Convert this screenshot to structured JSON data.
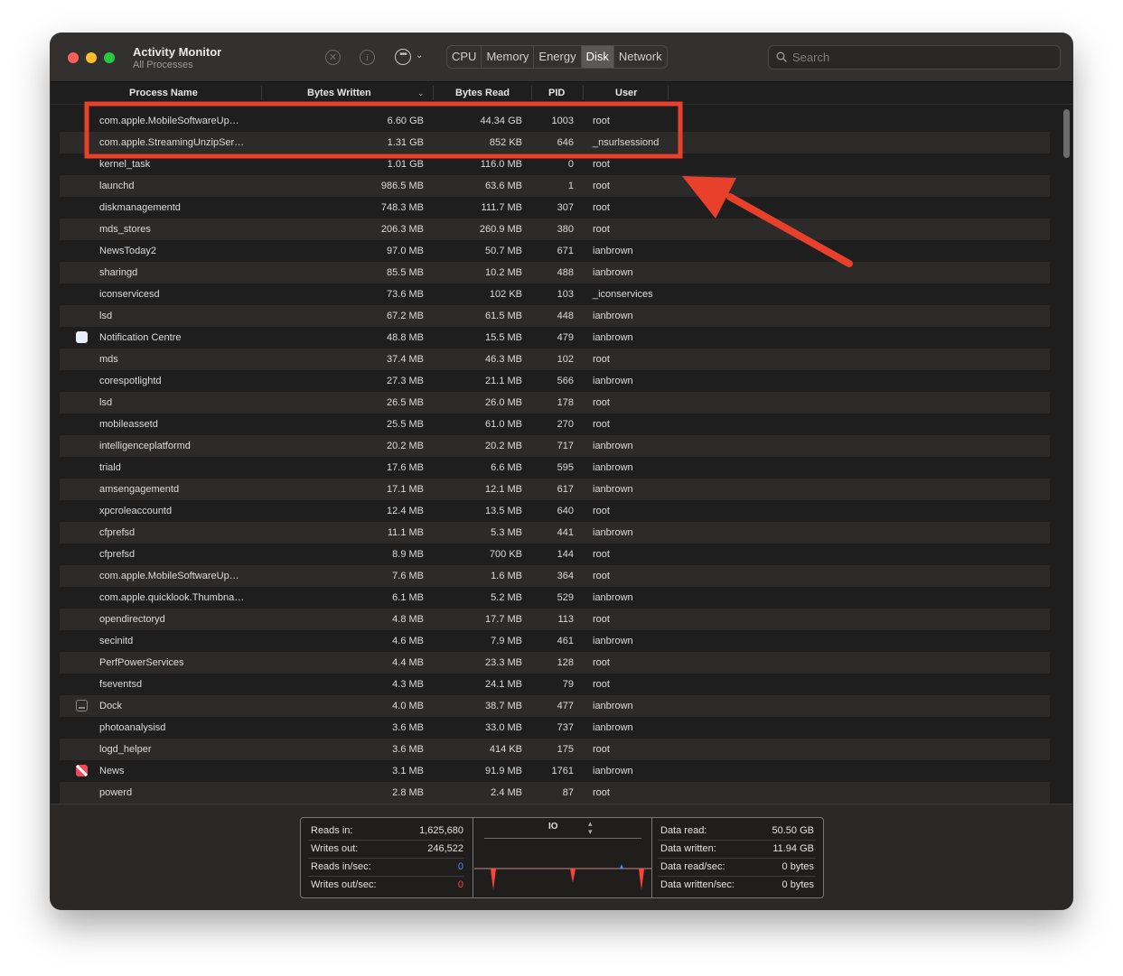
{
  "window": {
    "title": "Activity Monitor",
    "subtitle": "All Processes"
  },
  "toolbar": {
    "stop_icon": "x-circle-icon",
    "info_icon": "info-icon",
    "more_icon": "ellipsis-circle-icon",
    "tabs": [
      {
        "label": "CPU",
        "active": false
      },
      {
        "label": "Memory",
        "active": false
      },
      {
        "label": "Energy",
        "active": false
      },
      {
        "label": "Disk",
        "active": true
      },
      {
        "label": "Network",
        "active": false
      }
    ],
    "search_placeholder": "Search"
  },
  "columns": {
    "name": "Process Name",
    "bytes_written": "Bytes Written",
    "bytes_read": "Bytes Read",
    "pid": "PID",
    "user": "User"
  },
  "processes": [
    {
      "name": "com.apple.MobileSoftwareUp…",
      "bytes_written": "6.60 GB",
      "bytes_read": "44.34 GB",
      "pid": "1003",
      "user": "root"
    },
    {
      "name": "com.apple.StreamingUnzipSer…",
      "bytes_written": "1.31 GB",
      "bytes_read": "852 KB",
      "pid": "646",
      "user": "_nsurlsessiond"
    },
    {
      "name": "kernel_task",
      "bytes_written": "1.01 GB",
      "bytes_read": "116.0 MB",
      "pid": "0",
      "user": "root"
    },
    {
      "name": "launchd",
      "bytes_written": "986.5 MB",
      "bytes_read": "63.6 MB",
      "pid": "1",
      "user": "root"
    },
    {
      "name": "diskmanagementd",
      "bytes_written": "748.3 MB",
      "bytes_read": "111.7 MB",
      "pid": "307",
      "user": "root"
    },
    {
      "name": "mds_stores",
      "bytes_written": "206.3 MB",
      "bytes_read": "260.9 MB",
      "pid": "380",
      "user": "root"
    },
    {
      "name": "NewsToday2",
      "bytes_written": "97.0 MB",
      "bytes_read": "50.7 MB",
      "pid": "671",
      "user": "ianbrown"
    },
    {
      "name": "sharingd",
      "bytes_written": "85.5 MB",
      "bytes_read": "10.2 MB",
      "pid": "488",
      "user": "ianbrown"
    },
    {
      "name": "iconservicesd",
      "bytes_written": "73.6 MB",
      "bytes_read": "102 KB",
      "pid": "103",
      "user": "_iconservices"
    },
    {
      "name": "lsd",
      "bytes_written": "67.2 MB",
      "bytes_read": "61.5 MB",
      "pid": "448",
      "user": "ianbrown"
    },
    {
      "name": "Notification Centre",
      "bytes_written": "48.8 MB",
      "bytes_read": "15.5 MB",
      "pid": "479",
      "user": "ianbrown",
      "icon": "notification-centre-icon"
    },
    {
      "name": "mds",
      "bytes_written": "37.4 MB",
      "bytes_read": "46.3 MB",
      "pid": "102",
      "user": "root"
    },
    {
      "name": "corespotlightd",
      "bytes_written": "27.3 MB",
      "bytes_read": "21.1 MB",
      "pid": "566",
      "user": "ianbrown"
    },
    {
      "name": "lsd",
      "bytes_written": "26.5 MB",
      "bytes_read": "26.0 MB",
      "pid": "178",
      "user": "root"
    },
    {
      "name": "mobileassetd",
      "bytes_written": "25.5 MB",
      "bytes_read": "61.0 MB",
      "pid": "270",
      "user": "root"
    },
    {
      "name": "intelligenceplatformd",
      "bytes_written": "20.2 MB",
      "bytes_read": "20.2 MB",
      "pid": "717",
      "user": "ianbrown"
    },
    {
      "name": "triald",
      "bytes_written": "17.6 MB",
      "bytes_read": "6.6 MB",
      "pid": "595",
      "user": "ianbrown"
    },
    {
      "name": "amsengagementd",
      "bytes_written": "17.1 MB",
      "bytes_read": "12.1 MB",
      "pid": "617",
      "user": "ianbrown"
    },
    {
      "name": "xpcroleaccountd",
      "bytes_written": "12.4 MB",
      "bytes_read": "13.5 MB",
      "pid": "640",
      "user": "root"
    },
    {
      "name": "cfprefsd",
      "bytes_written": "11.1 MB",
      "bytes_read": "5.3 MB",
      "pid": "441",
      "user": "ianbrown"
    },
    {
      "name": "cfprefsd",
      "bytes_written": "8.9 MB",
      "bytes_read": "700 KB",
      "pid": "144",
      "user": "root"
    },
    {
      "name": "com.apple.MobileSoftwareUp…",
      "bytes_written": "7.6 MB",
      "bytes_read": "1.6 MB",
      "pid": "364",
      "user": "root"
    },
    {
      "name": "com.apple.quicklook.Thumbna…",
      "bytes_written": "6.1 MB",
      "bytes_read": "5.2 MB",
      "pid": "529",
      "user": "ianbrown"
    },
    {
      "name": "opendirectoryd",
      "bytes_written": "4.8 MB",
      "bytes_read": "17.7 MB",
      "pid": "113",
      "user": "root"
    },
    {
      "name": "secinitd",
      "bytes_written": "4.6 MB",
      "bytes_read": "7.9 MB",
      "pid": "461",
      "user": "ianbrown"
    },
    {
      "name": "PerfPowerServices",
      "bytes_written": "4.4 MB",
      "bytes_read": "23.3 MB",
      "pid": "128",
      "user": "root"
    },
    {
      "name": "fseventsd",
      "bytes_written": "4.3 MB",
      "bytes_read": "24.1 MB",
      "pid": "79",
      "user": "root"
    },
    {
      "name": "Dock",
      "bytes_written": "4.0 MB",
      "bytes_read": "38.7 MB",
      "pid": "477",
      "user": "ianbrown",
      "icon": "dock-icon"
    },
    {
      "name": "photoanalysisd",
      "bytes_written": "3.6 MB",
      "bytes_read": "33.0 MB",
      "pid": "737",
      "user": "ianbrown"
    },
    {
      "name": "logd_helper",
      "bytes_written": "3.6 MB",
      "bytes_read": "414 KB",
      "pid": "175",
      "user": "root"
    },
    {
      "name": "News",
      "bytes_written": "3.1 MB",
      "bytes_read": "91.9 MB",
      "pid": "1761",
      "user": "ianbrown",
      "icon": "news-app-icon"
    },
    {
      "name": "powerd",
      "bytes_written": "2.8 MB",
      "bytes_read": "2.4 MB",
      "pid": "87",
      "user": "root"
    }
  ],
  "footer": {
    "left": [
      {
        "label": "Reads in:",
        "value": "1,625,680"
      },
      {
        "label": "Writes out:",
        "value": "246,522"
      },
      {
        "label": "Reads in/sec:",
        "value": "0",
        "color": "#3d8bff"
      },
      {
        "label": "Writes out/sec:",
        "value": "0",
        "color": "#ff453a"
      }
    ],
    "chart_selector": "IO",
    "right": [
      {
        "label": "Data read:",
        "value": "50.50 GB"
      },
      {
        "label": "Data written:",
        "value": "11.94 GB"
      },
      {
        "label": "Data read/sec:",
        "value": "0 bytes"
      },
      {
        "label": "Data written/sec:",
        "value": "0 bytes"
      }
    ]
  },
  "colors": {
    "annotation": "#e8402a",
    "reads": "#3d8bff",
    "writes": "#ff453a"
  }
}
